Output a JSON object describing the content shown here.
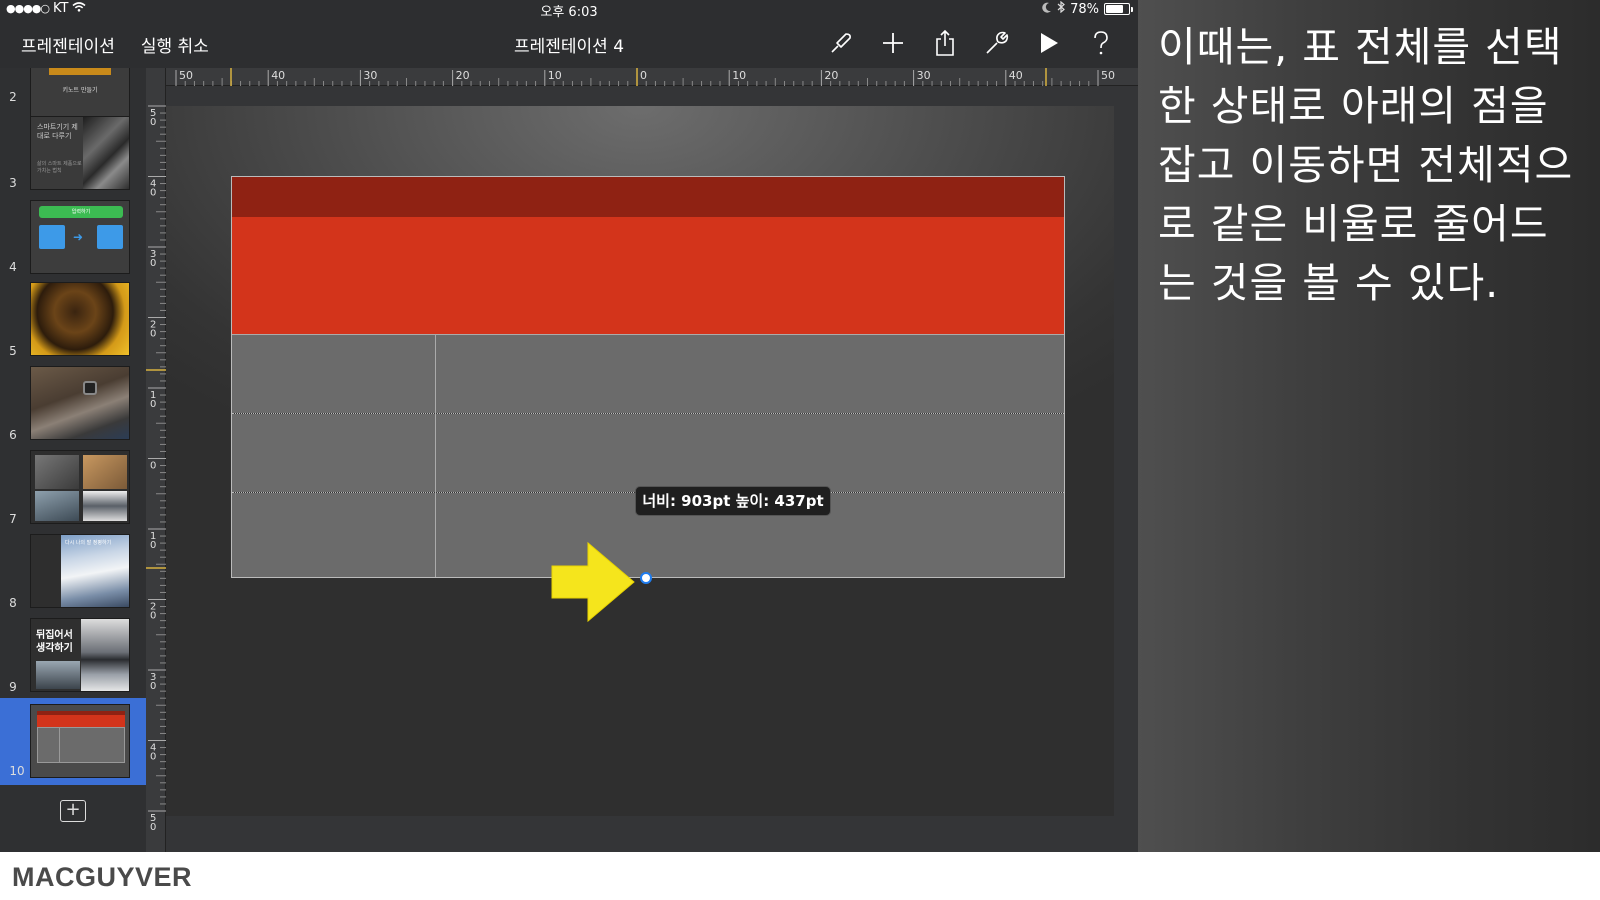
{
  "status_bar": {
    "carrier": "KT",
    "time": "오후 6:03",
    "battery": "78%",
    "battery_level": 0.78
  },
  "toolbar": {
    "presentations_label": "프레젠테이션",
    "undo_label": "실행 취소",
    "doc_title": "프레젠테이션 4",
    "tools": [
      "format-brush-icon",
      "plus-icon",
      "share-icon",
      "wrench-icon",
      "play-icon",
      "help-icon"
    ]
  },
  "slides": [
    {
      "number": "2",
      "text": "키노트 만들기"
    },
    {
      "number": "3",
      "text": "스마트기기 제대로 다루기",
      "subtext": "삶의 스마트 제품으로 가치는 법칙"
    },
    {
      "number": "4",
      "text": "입력하기"
    },
    {
      "number": "5",
      "text": ""
    },
    {
      "number": "6",
      "text": ""
    },
    {
      "number": "7",
      "text": ""
    },
    {
      "number": "8",
      "text": "다시 나의 말 정평하기"
    },
    {
      "number": "9",
      "text": "뒤집어서 생각하기"
    },
    {
      "number": "10",
      "text": ""
    }
  ],
  "selected_slide": "10",
  "ruler": {
    "horizontal": [
      "50",
      "40",
      "30",
      "20",
      "10",
      "0",
      "10",
      "20",
      "30",
      "40",
      "50"
    ],
    "vertical": [
      "50",
      "40",
      "30",
      "20",
      "10",
      "0",
      "10",
      "20",
      "30",
      "40",
      "50"
    ]
  },
  "table": {
    "header_colors": [
      "#8f2213",
      "#d3341b"
    ],
    "body_color": "#6b6b6b"
  },
  "size_tooltip": "너비: 903pt  높이: 437pt",
  "explanation": "이때는, 표 전체를 선택한 상태로 아래의 점을 잡고 이동하면 전체적으로 같은 비율로 줄어드는 것을 볼 수 있다.",
  "explanation_lines": [
    "이때는, 표 전체를 선택",
    "한 상태로 아래의 점을",
    "잡고 이동하면 전체적으",
    "로 같은 비율로 줄어드",
    "는 것을 볼 수 있다."
  ],
  "brand": "MACGUYVER"
}
